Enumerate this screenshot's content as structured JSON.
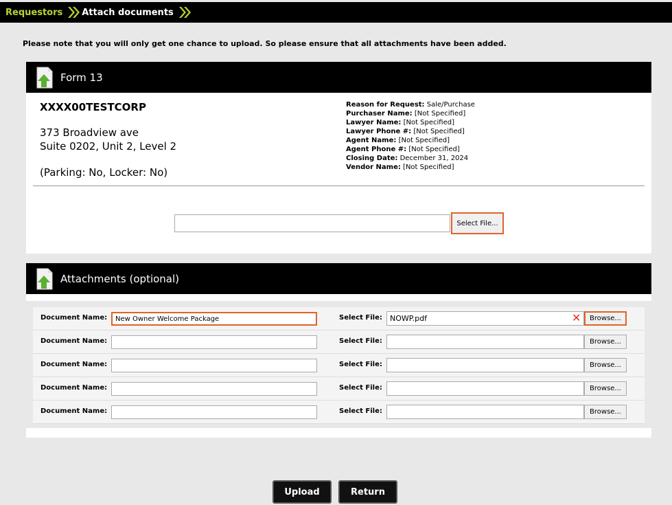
{
  "breadcrumb": {
    "parent": "Requestors",
    "current": "Attach documents"
  },
  "notice": "Please note that you will only get one chance to upload. So please ensure that all attachments have been added.",
  "form13": {
    "title": "Form 13",
    "corp": "XXXX00TESTCORP",
    "address1": "373 Broadview ave",
    "address2": "Suite 0202, Unit 2, Level 2",
    "parking": "(Parking: No, Locker: No)",
    "details": [
      {
        "label": "Reason for Request:",
        "value": "Sale/Purchase"
      },
      {
        "label": "Purchaser Name:",
        "value": "[Not Specified]"
      },
      {
        "label": "Lawyer Name:",
        "value": "[Not Specified]"
      },
      {
        "label": "Lawyer Phone #:",
        "value": "[Not Specified]"
      },
      {
        "label": "Agent Name:",
        "value": "[Not Specified]"
      },
      {
        "label": "Agent Phone #:",
        "value": "[Not Specified]"
      },
      {
        "label": "Closing Date:",
        "value": "December 31, 2024"
      },
      {
        "label": "Vendor Name:",
        "value": "[Not Specified]"
      }
    ],
    "select_file_label": "Select File..."
  },
  "attachments": {
    "title": "Attachments (optional)",
    "doc_label": "Document Name:",
    "file_label": "Select File:",
    "browse_label": "Browse...",
    "rows": [
      {
        "doc": "New Owner Welcome Package",
        "file": "NOWP.pdf"
      },
      {
        "doc": "",
        "file": ""
      },
      {
        "doc": "",
        "file": ""
      },
      {
        "doc": "",
        "file": ""
      },
      {
        "doc": "",
        "file": ""
      }
    ]
  },
  "buttons": {
    "upload": "Upload",
    "return": "Return"
  },
  "colors": {
    "accent": "#b8d432",
    "highlight": "#e0622a"
  }
}
